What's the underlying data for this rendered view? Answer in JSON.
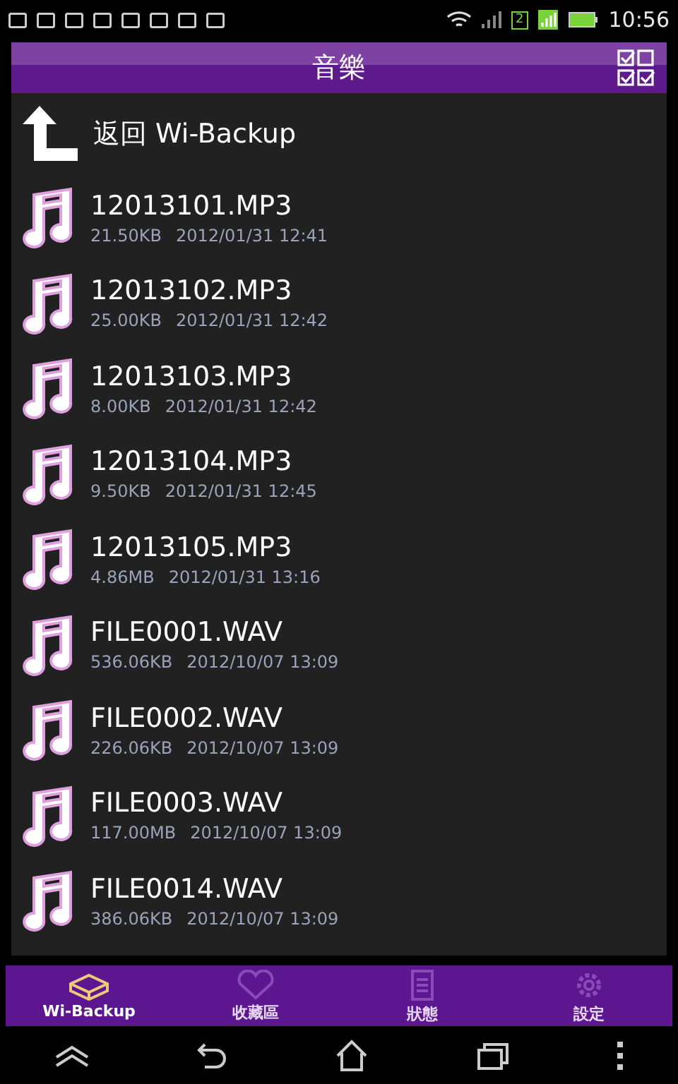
{
  "status_bar": {
    "sim_slot": "2",
    "time": "10:56"
  },
  "header": {
    "title": "音樂"
  },
  "back_row": {
    "label": "返回 Wi-Backup"
  },
  "files": [
    {
      "name": "12013101.MP3",
      "size": "21.50KB",
      "date": "2012/01/31 12:41"
    },
    {
      "name": "12013102.MP3",
      "size": "25.00KB",
      "date": "2012/01/31 12:42"
    },
    {
      "name": "12013103.MP3",
      "size": "8.00KB",
      "date": "2012/01/31 12:42"
    },
    {
      "name": "12013104.MP3",
      "size": "9.50KB",
      "date": "2012/01/31 12:45"
    },
    {
      "name": "12013105.MP3",
      "size": "4.86MB",
      "date": "2012/01/31 13:16"
    },
    {
      "name": "FILE0001.WAV",
      "size": "536.06KB",
      "date": "2012/10/07 13:09"
    },
    {
      "name": "FILE0002.WAV",
      "size": "226.06KB",
      "date": "2012/10/07 13:09"
    },
    {
      "name": "FILE0003.WAV",
      "size": "117.00MB",
      "date": "2012/10/07 13:09"
    },
    {
      "name": "FILE0014.WAV",
      "size": "386.06KB",
      "date": "2012/10/07 13:09"
    }
  ],
  "tabs": [
    {
      "kind": "box",
      "label": "Wi-Backup",
      "selected": true
    },
    {
      "kind": "heart",
      "label": "收藏區",
      "selected": false
    },
    {
      "kind": "doc",
      "label": "狀態",
      "selected": false
    },
    {
      "kind": "gear",
      "label": "設定",
      "selected": false
    }
  ]
}
